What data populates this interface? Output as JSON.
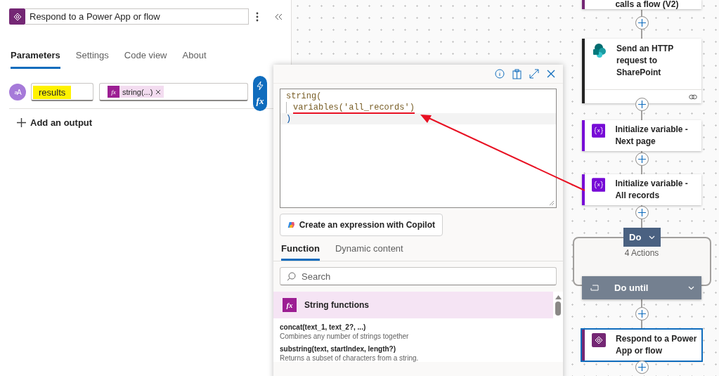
{
  "header": {
    "title": "Respond to a Power App or flow"
  },
  "tabs": [
    {
      "label": "Parameters",
      "selected": true
    },
    {
      "label": "Settings",
      "selected": false
    },
    {
      "label": "Code view",
      "selected": false
    },
    {
      "label": "About",
      "selected": false
    }
  ],
  "outputs": [
    {
      "type_badge": "aA",
      "name": "results",
      "highlighted": true,
      "tokens": [
        {
          "icon_text": "fx",
          "label": "string(...)"
        }
      ]
    }
  ],
  "insert_toolbar": {
    "expression_text": "fx"
  },
  "add_output": "Add an output",
  "expression_editor": {
    "lines": [
      {
        "text": "string(",
        "indented": false,
        "marked": false,
        "current": false
      },
      {
        "text": "variables('all_records')",
        "indented": true,
        "marked": true,
        "current": false
      },
      {
        "text": ")",
        "indented": false,
        "marked": false,
        "current": true
      }
    ],
    "copilot_button": "Create an expression with Copilot",
    "tabs": [
      {
        "label": "Function",
        "selected": true
      },
      {
        "label": "Dynamic content",
        "selected": false
      }
    ],
    "search": {
      "placeholder": "Search"
    },
    "groups": [
      {
        "icon_text": "fx",
        "title": "String functions",
        "functions": [
          {
            "signature": "concat(text_1, text_2?, ...)",
            "description": "Combines any number of strings together"
          },
          {
            "signature": "substring(text, startIndex, length?)",
            "description": "Returns a subset of characters from a string."
          }
        ]
      }
    ]
  },
  "flow": {
    "nodes": [
      {
        "kind": "power-app",
        "title": "calls a flow (V2)",
        "selected": false
      },
      {
        "kind": "sharepoint",
        "title": "Send an HTTP request to SharePoint",
        "selected": false
      },
      {
        "kind": "variable",
        "title": "Initialize variable - Next page",
        "selected": false
      },
      {
        "kind": "variable",
        "title": "Initialize variable - All records",
        "selected": false
      },
      {
        "kind": "loop",
        "title": "Do until",
        "scope": "Do",
        "summary": "4 Actions",
        "selected": false
      },
      {
        "kind": "power-app",
        "title": "Respond to a Power App or flow",
        "selected": true
      }
    ]
  }
}
